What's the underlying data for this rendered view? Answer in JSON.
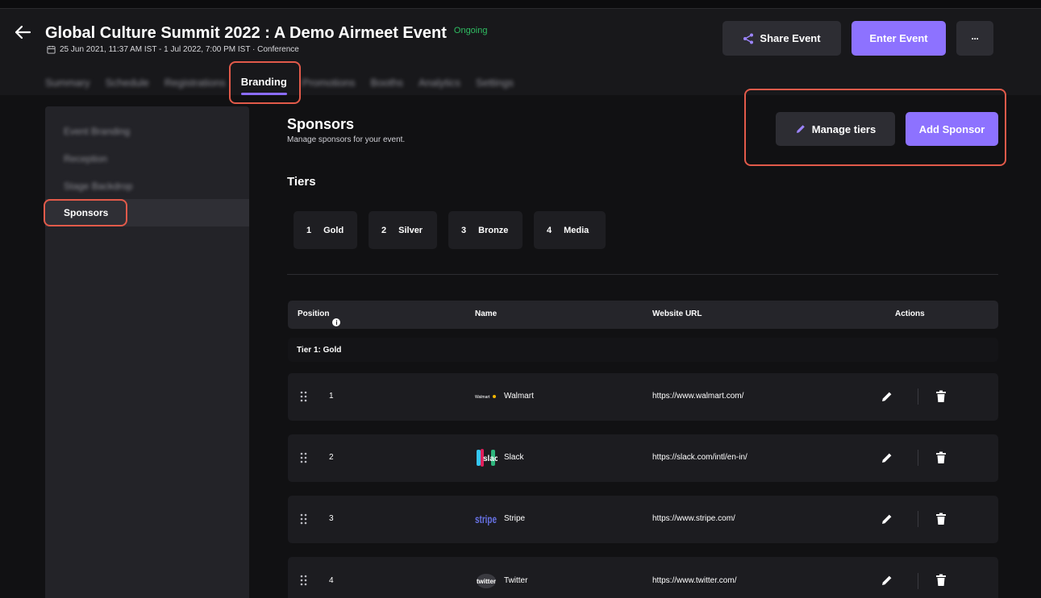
{
  "event": {
    "title": "Global Culture Summit 2022 : A Demo Airmeet Event",
    "status": "Ongoing",
    "meta": "25 Jun 2021, 11:37 AM IST - 1 Jul 2022, 7:00 PM IST · Conference"
  },
  "header_buttons": {
    "share": "Share Event",
    "enter": "Enter Event",
    "more": "···"
  },
  "tabs": [
    "Summary",
    "Schedule",
    "Registrations",
    "Branding",
    "Promotions",
    "Booths",
    "Analytics",
    "Settings"
  ],
  "sidebar": {
    "items": [
      "Event Branding",
      "Reception",
      "Stage Backdrop"
    ],
    "active": "Sponsors"
  },
  "page": {
    "title": "Sponsors",
    "subtitle": "Manage sponsors for your event.",
    "manage_tiers": "Manage tiers",
    "add_sponsor": "Add Sponsor",
    "tiers_label": "Tiers"
  },
  "tiers": [
    {
      "num": "1",
      "name": "Gold"
    },
    {
      "num": "2",
      "name": "Silver"
    },
    {
      "num": "3",
      "name": "Bronze"
    },
    {
      "num": "4",
      "name": "Media"
    }
  ],
  "table": {
    "headers": {
      "position": "Position",
      "name": "Name",
      "url": "Website URL",
      "actions": "Actions"
    },
    "group_label": "Tier 1: Gold",
    "rows": [
      {
        "pos": "1",
        "name": "Walmart",
        "url": "https://www.walmart.com/",
        "logo": "walmart-logo",
        "logo_text": "Walmart"
      },
      {
        "pos": "2",
        "name": "Slack",
        "url": "https://slack.com/intl/en-in/",
        "logo": "slack-logo",
        "logo_text": "slack"
      },
      {
        "pos": "3",
        "name": "Stripe",
        "url": "https://www.stripe.com/",
        "logo": "stripe-logo",
        "logo_text": "stripe"
      },
      {
        "pos": "4",
        "name": "Twitter",
        "url": "https://www.twitter.com/",
        "logo": "twitter-logo",
        "logo_text": "twitter"
      }
    ]
  },
  "colors": {
    "accent": "#8d72ff",
    "status": "#2fbe62",
    "highlight": "#e25a4a"
  }
}
